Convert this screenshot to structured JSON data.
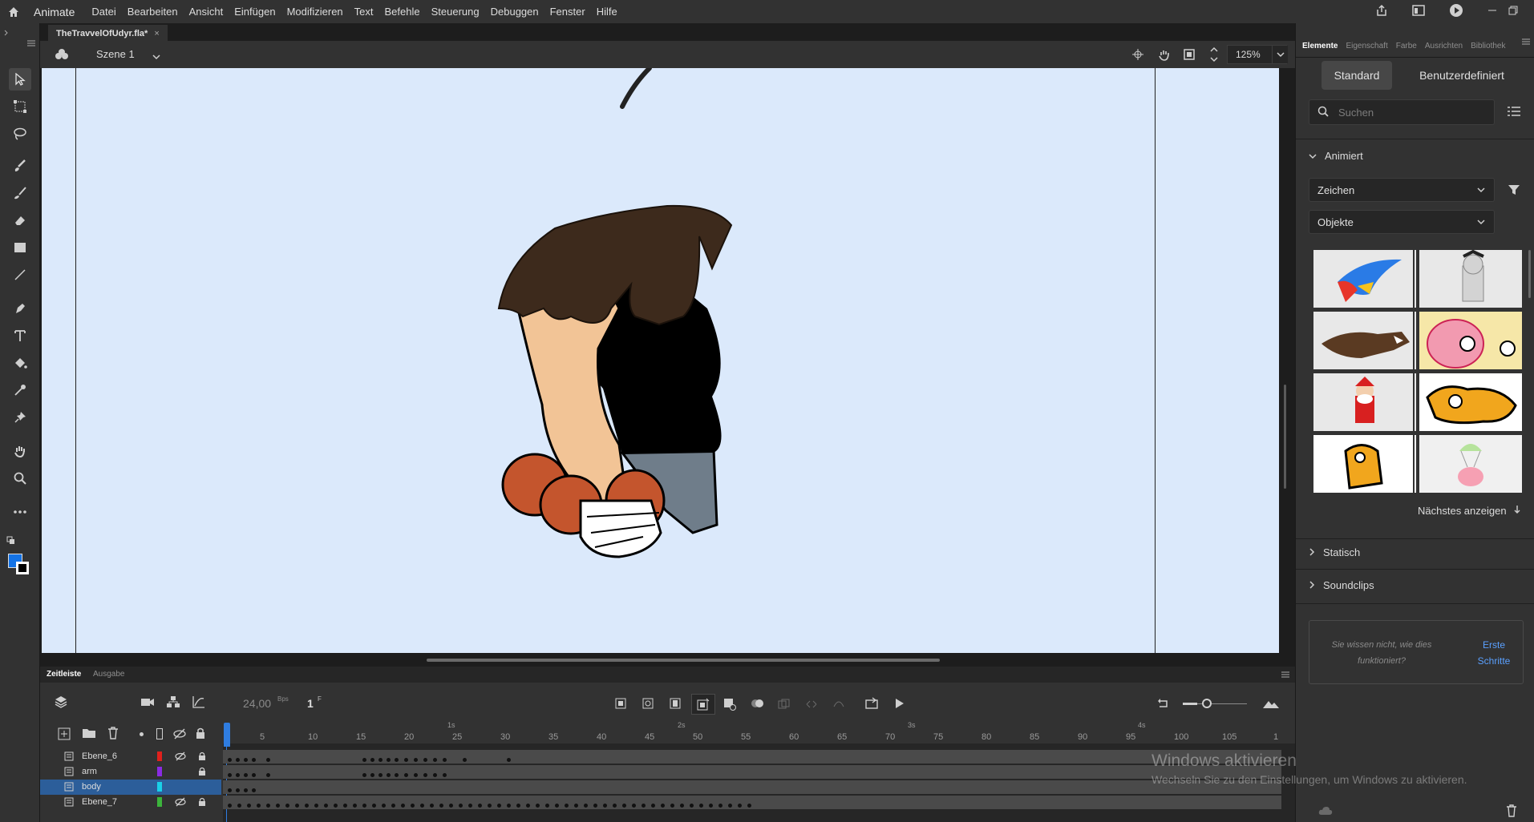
{
  "app": {
    "name": "Animate"
  },
  "menu": [
    "Datei",
    "Bearbeiten",
    "Ansicht",
    "Einfügen",
    "Modifizieren",
    "Text",
    "Befehle",
    "Steuerung",
    "Debuggen",
    "Fenster",
    "Hilfe"
  ],
  "document_tab": {
    "title": "TheTravvelOfUdyr.fla*",
    "close": "×"
  },
  "scene": {
    "label": "Szene 1",
    "zoom": "125%"
  },
  "right_panel": {
    "tabs": [
      "Elemente",
      "Eigenschaft",
      "Farbe",
      "Ausrichten",
      "Bibliothek"
    ],
    "active_tab": "Elemente",
    "segment_standard": "Standard",
    "segment_custom": "Benutzerdefiniert",
    "search_placeholder": "Suchen",
    "section_animated": "Animiert",
    "dropdown_type": "Zeichen",
    "dropdown_objects": "Objekte",
    "show_more": "Nächstes anzeigen",
    "section_static": "Statisch",
    "section_sounds": "Soundclips",
    "help_text": "Sie wissen nicht, wie dies funktioniert?",
    "help_link": "Erste Schritte"
  },
  "timeline": {
    "tab_timeline": "Zeitleiste",
    "tab_output": "Ausgabe",
    "fps": "24,00",
    "fps_unit": "Bps",
    "frame": "1",
    "frame_unit": "F",
    "seconds_labels": [
      "1s",
      "2s",
      "3s",
      "4s"
    ],
    "frame_labels": [
      "5",
      "10",
      "15",
      "20",
      "25",
      "30",
      "35",
      "40",
      "45",
      "50",
      "55",
      "60",
      "65",
      "70",
      "75",
      "80",
      "85",
      "90",
      "95",
      "100",
      "105",
      "1"
    ],
    "layers": [
      {
        "name": "Ebene_6",
        "color": "#e0201c",
        "hidden": true,
        "locked": true,
        "selected": false
      },
      {
        "name": "arm",
        "color": "#8a2be2",
        "hidden": false,
        "locked": true,
        "selected": false
      },
      {
        "name": "body",
        "color": "#19d0e8",
        "hidden": false,
        "locked": false,
        "selected": true
      },
      {
        "name": "Ebene_7",
        "color": "#3cb43c",
        "hidden": true,
        "locked": true,
        "selected": false
      }
    ]
  },
  "watermark": {
    "title": "Windows aktivieren",
    "subtitle": "Wechseln Sie zu den Einstellungen, um Windows zu aktivieren."
  },
  "colors": {
    "accent": "#1473e6",
    "stage_bg": "#dbe9fb",
    "fill_color": "#1473e6",
    "stroke_color": "#000000"
  }
}
